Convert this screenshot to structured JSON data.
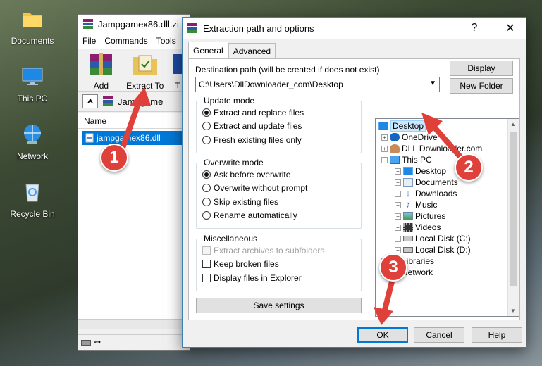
{
  "desktop": {
    "icons": [
      {
        "label": "Documents"
      },
      {
        "label": "This PC"
      },
      {
        "label": "Network"
      },
      {
        "label": "Recycle Bin"
      }
    ]
  },
  "winrar": {
    "title": "Jampgamex86.dll.zi",
    "menu": [
      "File",
      "Commands",
      "Tools"
    ],
    "toolbar": {
      "add": "Add",
      "extract": "Extract To",
      "third": "T"
    },
    "path": "Jampgame",
    "column_name": "Name",
    "file": "jampgamex86.dll"
  },
  "dialog": {
    "title": "Extraction path and options",
    "help_glyph": "?",
    "close_glyph": "✕",
    "tabs": [
      "General",
      "Advanced"
    ],
    "dest_label": "Destination path (will be created if does not exist)",
    "dest_value": "C:\\Users\\DllDownloader_com\\Desktop",
    "display_button": "Display",
    "new_folder_button": "New Folder",
    "update_mode": {
      "legend": "Update mode",
      "options": [
        "Extract and replace files",
        "Extract and update files",
        "Fresh existing files only"
      ],
      "selected": 0
    },
    "overwrite_mode": {
      "legend": "Overwrite mode",
      "options": [
        "Ask before overwrite",
        "Overwrite without prompt",
        "Skip existing files",
        "Rename automatically"
      ],
      "selected": 0
    },
    "misc": {
      "legend": "Miscellaneous",
      "options": [
        "Extract archives to subfolders",
        "Keep broken files",
        "Display files in Explorer"
      ]
    },
    "save_settings": "Save settings",
    "tree": [
      {
        "label": "Desktop",
        "icon": "desktop-icon",
        "selected": true
      },
      {
        "label": "OneDrive",
        "icon": "cloud-icon"
      },
      {
        "label": "DLL Downloader.com",
        "icon": "user-icon"
      },
      {
        "label": "This PC",
        "icon": "computer-icon"
      },
      {
        "label": "Desktop",
        "icon": "desktop-icon"
      },
      {
        "label": "Documents",
        "icon": "documents-icon"
      },
      {
        "label": "Downloads",
        "icon": "download-icon"
      },
      {
        "label": "Music",
        "icon": "music-icon"
      },
      {
        "label": "Pictures",
        "icon": "pictures-icon"
      },
      {
        "label": "Videos",
        "icon": "video-icon"
      },
      {
        "label": "Local Disk (C:)",
        "icon": "drive-icon"
      },
      {
        "label": "Local Disk (D:)",
        "icon": "drive-icon"
      },
      {
        "label": "Libraries",
        "icon": "library-icon"
      },
      {
        "label": "Network",
        "icon": "network-icon"
      }
    ],
    "ok": "OK",
    "cancel": "Cancel",
    "help": "Help"
  },
  "markers": [
    "1",
    "2",
    "3"
  ],
  "colors": {
    "accent": "#0078d7",
    "marker": "#e0403a",
    "selection": "#cce8ff"
  }
}
